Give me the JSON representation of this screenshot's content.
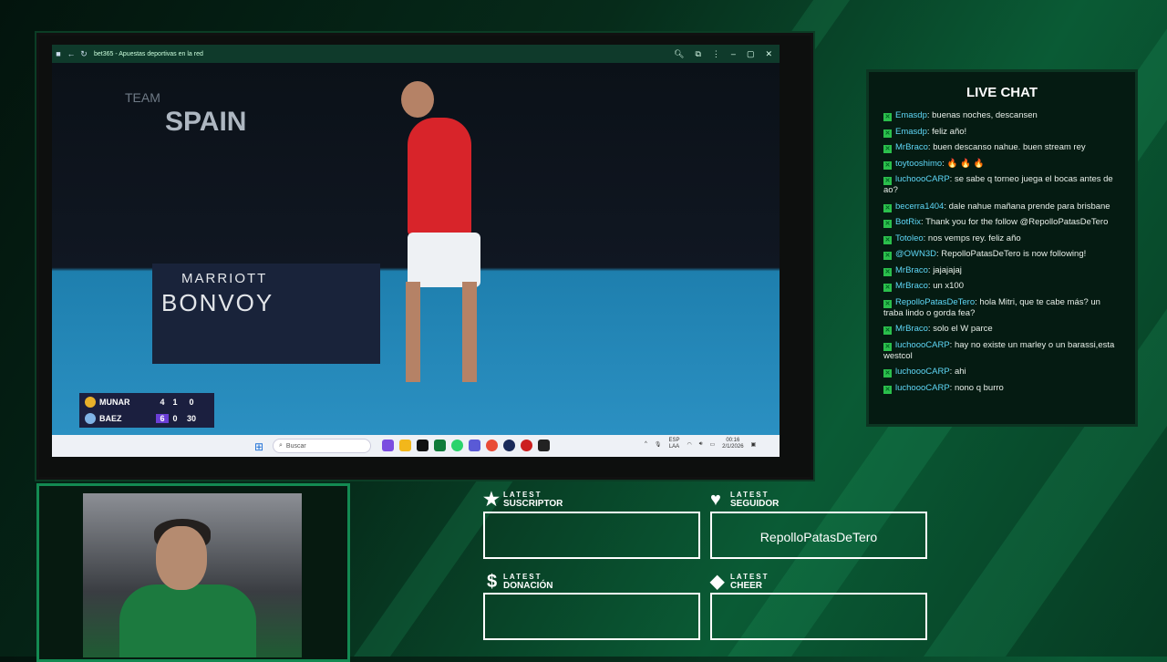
{
  "window": {
    "title": "bet365 - Apuestas deportivas en la red"
  },
  "video": {
    "team_small": "TEAM",
    "team": "SPAIN",
    "sponsor_top": "MARRIOTT",
    "sponsor_bottom": "BONVOY"
  },
  "scoreboard": {
    "rows": [
      {
        "name": "MUNAR",
        "s1": "4",
        "s2": "1",
        "pts": "0"
      },
      {
        "name": "BAEZ",
        "s1": "6",
        "s2": "0",
        "pts": "30"
      }
    ]
  },
  "taskbar": {
    "search_placeholder": "Buscar",
    "lang_top": "ESP",
    "lang_bottom": "LAA",
    "time": "00:16",
    "date": "2/1/2026"
  },
  "chat": {
    "title": "LIVE CHAT",
    "messages": [
      {
        "user": "Emasdp",
        "text": "buenas noches, descansen"
      },
      {
        "user": "Emasdp",
        "text": "feliz año!"
      },
      {
        "user": "MrBraco",
        "text": "buen descanso nahue. buen stream rey"
      },
      {
        "user": "toytooshimo",
        "text": "🔥 🔥 🔥"
      },
      {
        "user": "luchoooCARP",
        "text": "se sabe q torneo juega el bocas antes de ao?"
      },
      {
        "user": "becerra1404",
        "text": "dale nahue mañana prende para brisbane"
      },
      {
        "user": "BotRix",
        "text": "Thank you for the follow @RepolloPatasDeTero"
      },
      {
        "user": "Totoleo",
        "text": "nos vemps rey. feliz año"
      },
      {
        "user": "@OWN3D",
        "text": "RepolloPatasDeTero is now following!"
      },
      {
        "user": "MrBraco",
        "text": "jajajajaj"
      },
      {
        "user": "MrBraco",
        "text": "un x100"
      },
      {
        "user": "RepolloPatasDeTero",
        "text": "hola Mitri, que te cabe más? un traba lindo o gorda fea?"
      },
      {
        "user": "MrBraco",
        "text": "solo el W parce"
      },
      {
        "user": "luchoooCARP",
        "text": "hay no existe un marley o un barassi,esta westcol"
      },
      {
        "user": "luchoooCARP",
        "text": "ahi"
      },
      {
        "user": "luchoooCARP",
        "text": "nono q burro"
      }
    ]
  },
  "widgets": {
    "suscriptor": {
      "small": "LATEST",
      "big": "SUSCRIPTOR",
      "value": ""
    },
    "seguidor": {
      "small": "LATEST",
      "big": "SEGUIDOR",
      "value": "RepolloPatasDeTero"
    },
    "donacion": {
      "small": "LATEST",
      "big": "DONACIÓN",
      "value": ""
    },
    "cheer": {
      "small": "LATEST",
      "big": "CHEER",
      "value": ""
    }
  }
}
